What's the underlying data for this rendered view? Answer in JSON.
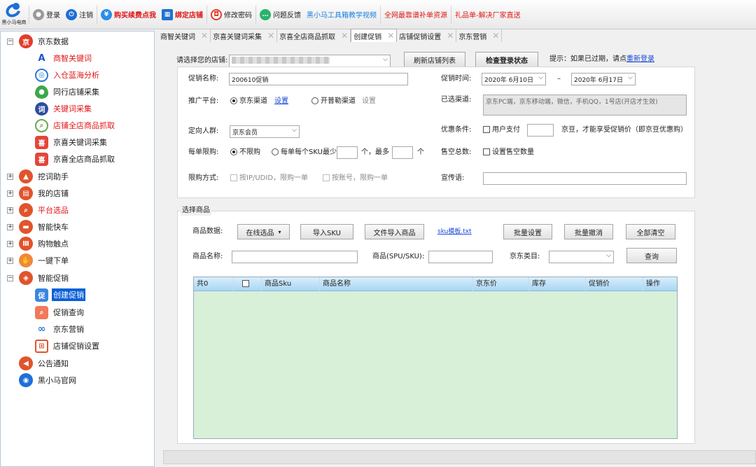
{
  "toolbar": {
    "logo_text": "黑小马电商",
    "items": [
      {
        "label": "登录",
        "color": "#9a9a9a",
        "icon": "user-icon",
        "red": false
      },
      {
        "label": "注销",
        "color": "#1a6fd6",
        "icon": "power-icon",
        "red": false
      },
      {
        "label": "购买续费点我",
        "color": "#2a8ee8",
        "icon": "yen-icon",
        "red": true
      },
      {
        "label": "绑定店铺",
        "color": "#1f72d0",
        "icon": "store-icon",
        "red": true
      },
      {
        "label": "修改密码",
        "color": "#e23d2b",
        "icon": "lock-icon",
        "red": false
      },
      {
        "label": "问题反馈",
        "color": "#2bb36a",
        "icon": "chat-icon",
        "red": false
      },
      {
        "label": "黑小马工具箱教学视频",
        "color": "",
        "icon": "",
        "blue": true
      },
      {
        "label": "全网最靠谱补单资源",
        "color": "",
        "icon": "",
        "red": true
      },
      {
        "label": "礼品单-解决厂家直送",
        "color": "",
        "icon": "",
        "red": true
      }
    ]
  },
  "sidebar": {
    "jd_data": "京东数据",
    "jd_children": [
      "商智关键词",
      "入仓蓝海分析",
      "同行店铺采集",
      "关键词采集",
      "店铺全店商品抓取",
      "京喜关键词采集",
      "京喜全店商品抓取"
    ],
    "groups": [
      "挖词助手",
      "我的店铺",
      "平台选品",
      "智能快车",
      "购物触点",
      "一键下单",
      "智能促销"
    ],
    "promo_children": [
      "创建促销",
      "促销查询",
      "京东营销",
      "店铺促销设置"
    ],
    "notice": "公告通知",
    "website": "黑小马官网"
  },
  "tabs": [
    "商智关键词",
    "京喜关键词采集",
    "京喜全店商品抓取",
    "创建促销",
    "店铺促销设置",
    "京东营销"
  ],
  "store": {
    "label": "请选择您的店铺:",
    "value": "",
    "refresh_btn": "刷新店铺列表",
    "check_btn": "检查登录状态",
    "hint": "提示：如果已过期，请点",
    "relogin": "重新登录"
  },
  "promo": {
    "name_label": "促销名称:",
    "name_value": "200610促销",
    "time_label": "促销时间:",
    "start_date": "2020年 6月10日",
    "dash": "–",
    "end_date": "2020年 6月17日",
    "platform_label": "推广平台:",
    "jd_channel": "京东渠道",
    "jd_channel_set": "设置",
    "kpl_channel": "开普勒渠道",
    "kpl_channel_set": "设置",
    "selected_channel_label": "已选渠道:",
    "selected_channel_value": "京东PC端，京东移动端，微信，手机QQ，1号店(开店才生效)",
    "crowd_label": "定向人群:",
    "crowd_value": "京东会员",
    "discount_label": "优惠条件:",
    "user_pay": "用户支付",
    "jd_bean_text": "京豆，才能享受促销价（即京豆优惠购）",
    "limit_label": "每单限购:",
    "no_limit": "不限购",
    "per_sku_min": "每单每个SKU最少",
    "unit_min": "个，最多",
    "unit": "个",
    "sold_total_label": "售空总数:",
    "set_sold_total": "设置售空数量",
    "limit_mode_label": "限购方式:",
    "by_ip": "按IP/UDID，限购一单",
    "by_account": "按账号，限购一单",
    "slogan_label": "宣传语:"
  },
  "goods": {
    "section_title": "选择商品",
    "data_label": "商品数据:",
    "online_select": "在线选品",
    "import_sku": "导入SKU",
    "file_import": "文件导入商品",
    "template": "sku模板.txt",
    "batch_set": "批量设置",
    "batch_cancel": "批量撤消",
    "clear_all": "全部清空",
    "name_label": "商品名称:",
    "spu_label": "商品(SPU/SKU):",
    "category_label": "京东类目:",
    "query_btn": "查询",
    "columns": [
      "共0",
      "",
      "商品Sku",
      "商品名称",
      "京东价",
      "库存",
      "促销价",
      "操作"
    ]
  },
  "colors": {
    "accent": "#0a60d8",
    "red_text": "#e01616",
    "grid_bg": "#d8f0d8"
  }
}
